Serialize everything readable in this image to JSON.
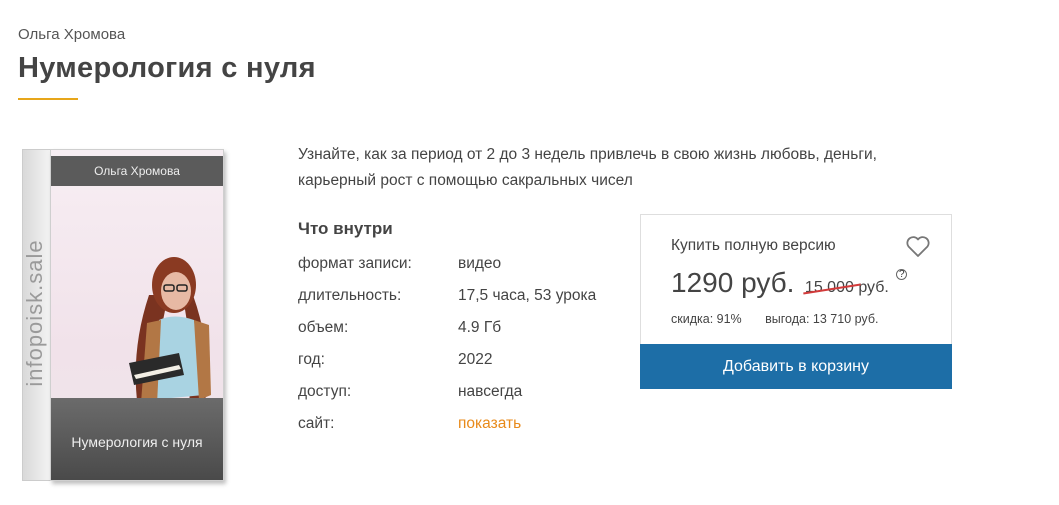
{
  "header": {
    "author": "Ольга Хромова",
    "title": "Нумерология с нуля"
  },
  "product_box": {
    "spine_text": "infopoisk.sale",
    "top_band_text": "Ольга Хромова",
    "bottom_band_text": "Нумерология с нуля"
  },
  "description": "Узнайте, как за период от 2 до 3 недель привлечь в свою жизнь любовь, деньги, карьерный рост с помощью сакральных чисел",
  "inside": {
    "title": "Что внутри",
    "rows": [
      {
        "label": "формат записи:",
        "value": "видео"
      },
      {
        "label": "длительность:",
        "value": "17,5 часа, 53 урока"
      },
      {
        "label": "объем:",
        "value": "4.9 Гб"
      },
      {
        "label": "год:",
        "value": "2022"
      },
      {
        "label": "доступ:",
        "value": "навсегда"
      },
      {
        "label": "сайт:",
        "value": "показать"
      }
    ]
  },
  "buy": {
    "label": "Купить полную версию",
    "price": "1290 руб.",
    "old_price": "15 000",
    "old_price_unit": "руб.",
    "help_icon": "?",
    "discount": "скидка: 91%",
    "savings": "выгода: 13 710 руб.",
    "cart_button": "Добавить в корзину"
  },
  "colors": {
    "accent": "#e7a61a",
    "link": "#e88a1a",
    "button": "#1d6ea7",
    "strike": "#d23b3b"
  },
  "icons": {
    "favorite": "heart-icon",
    "help": "question-circle-icon"
  }
}
